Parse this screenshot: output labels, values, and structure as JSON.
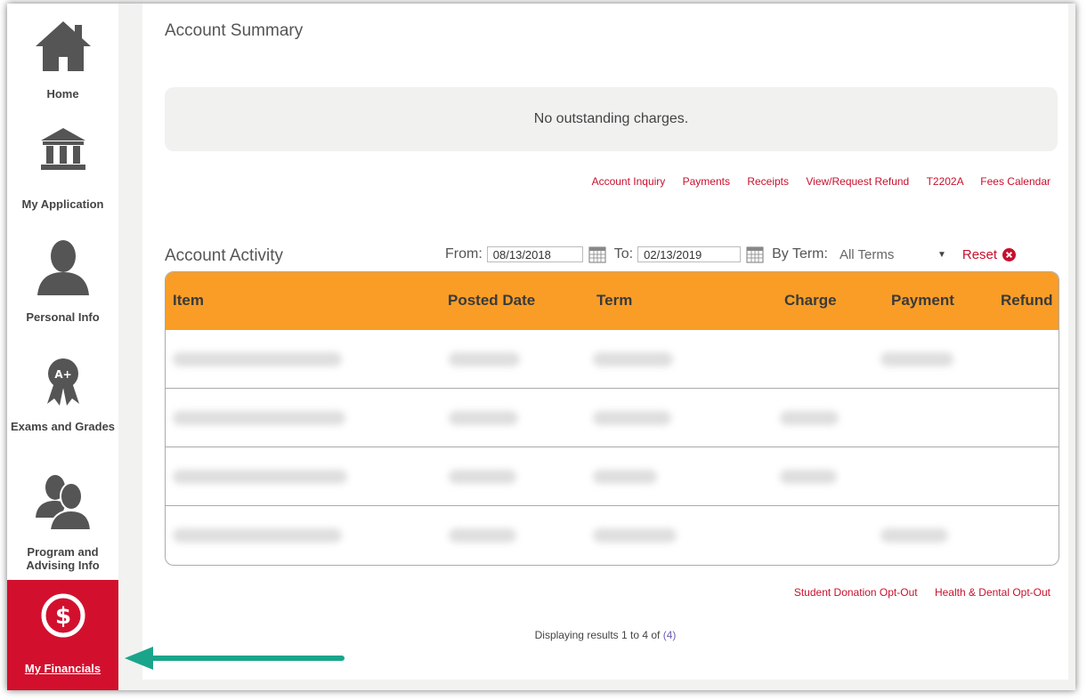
{
  "sidebar": {
    "items": [
      {
        "label": "Home",
        "icon": "home-icon"
      },
      {
        "label": "My Application",
        "icon": "institution-icon"
      },
      {
        "label": "Personal Info",
        "icon": "person-icon"
      },
      {
        "label": "Exams and Grades",
        "icon": "award-ribbon-icon"
      },
      {
        "label": "Program and Advising Info",
        "icon": "people-icon"
      },
      {
        "label": "My Financials",
        "icon": "dollar-circle-icon",
        "active": true
      }
    ]
  },
  "account_summary": {
    "title": "Account Summary",
    "message": "No outstanding charges.",
    "links": [
      "Account Inquiry",
      "Payments",
      "Receipts",
      "View/Request Refund",
      "T2202A",
      "Fees Calendar"
    ]
  },
  "account_activity": {
    "title": "Account Activity",
    "from_label": "From:",
    "from_value": "08/13/2018",
    "to_label": "To:",
    "to_value": "02/13/2019",
    "term_label": "By Term:",
    "term_value": "All Terms",
    "reset_label": "Reset",
    "columns": [
      "Item",
      "Posted Date",
      "Term",
      "Charge",
      "Payment",
      "Refund"
    ]
  },
  "opt_out_links": [
    "Student Donation Opt-Out",
    "Health & Dental Opt-Out"
  ],
  "results": {
    "prefix": "Displaying results 1 to 4 of ",
    "count": "(4)"
  },
  "colors": {
    "accent_red": "#c8102e",
    "header_orange": "#f99d27",
    "annotation_arrow": "#1aa58b"
  }
}
